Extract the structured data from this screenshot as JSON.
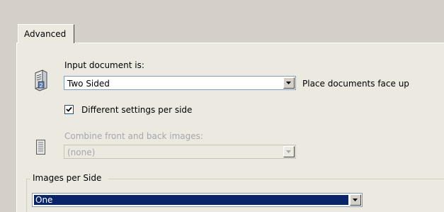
{
  "tabs": [
    {
      "label": "Advanced"
    }
  ],
  "input_document": {
    "label": "Input document is:",
    "value": "Two Sided",
    "hint": "Place documents face up",
    "icon": "two-sided-document-icon"
  },
  "different_settings": {
    "label": "Different settings per side",
    "checked": true
  },
  "combine_images": {
    "label": "Combine front and back images:",
    "value": "(none)",
    "enabled": false,
    "icon": "document-icon"
  },
  "images_per_side": {
    "group_label": "Images per Side",
    "value": "One"
  }
}
